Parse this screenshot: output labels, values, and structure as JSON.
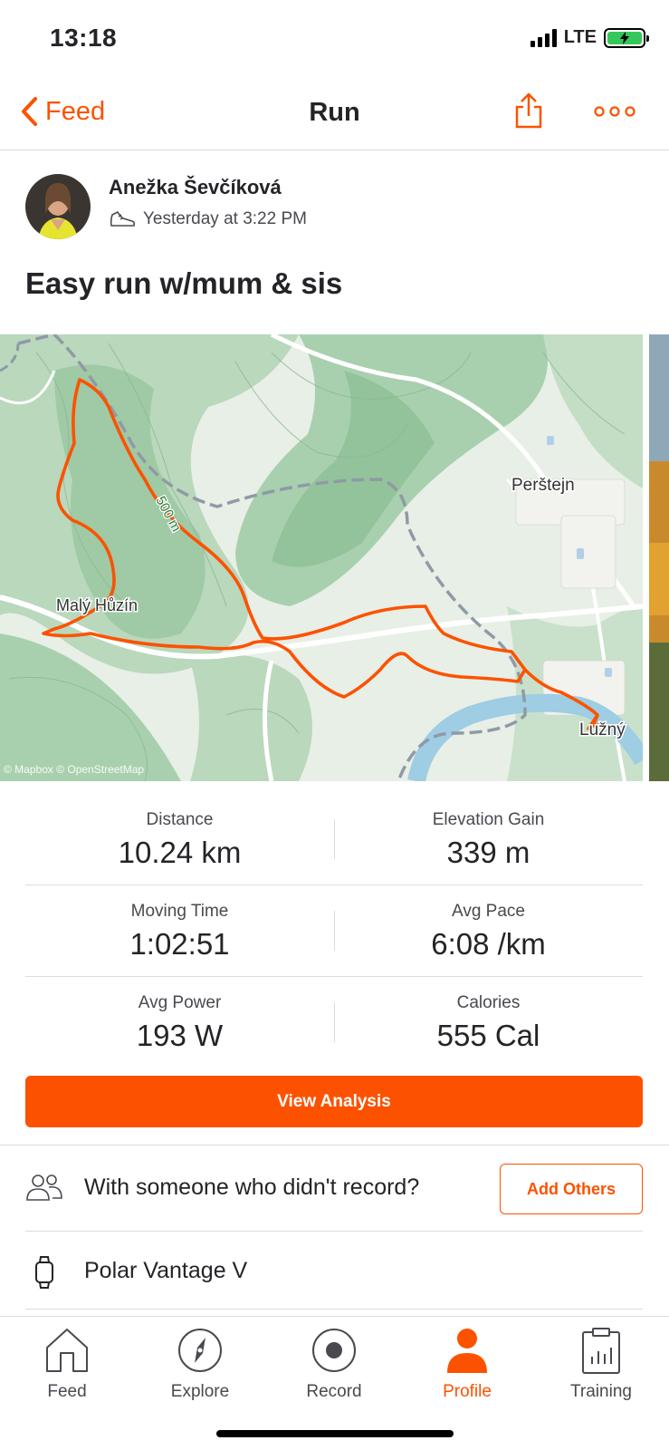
{
  "status": {
    "time": "13:18",
    "network": "LTE"
  },
  "nav": {
    "back_label": "Feed",
    "title": "Run"
  },
  "athlete": {
    "name": "Anežka Ševčíková",
    "timestamp": "Yesterday at 3:22 PM"
  },
  "activity": {
    "title": "Easy run w/mum & sis"
  },
  "map": {
    "labels": {
      "town_1": "Perštejn",
      "town_2": "Malý Hůzín",
      "town_3": "Lužný",
      "contour": "500 m",
      "attribution": "© Mapbox © OpenStreetMap"
    },
    "route_color": "#fc5200"
  },
  "stats": [
    {
      "label": "Distance",
      "value": "10.24 km"
    },
    {
      "label": "Elevation Gain",
      "value": "339 m"
    },
    {
      "label": "Moving Time",
      "value": "1:02:51"
    },
    {
      "label": "Avg Pace",
      "value": "6:08 /km"
    },
    {
      "label": "Avg Power",
      "value": "193 W"
    },
    {
      "label": "Calories",
      "value": "555 Cal"
    }
  ],
  "actions": {
    "view_analysis": "View Analysis",
    "others_prompt": "With someone who didn't record?",
    "add_others": "Add Others",
    "device": "Polar Vantage V"
  },
  "tabs": [
    {
      "label": "Feed",
      "icon": "home-icon",
      "active": false
    },
    {
      "label": "Explore",
      "icon": "compass-icon",
      "active": false
    },
    {
      "label": "Record",
      "icon": "record-icon",
      "active": false
    },
    {
      "label": "Profile",
      "icon": "profile-icon",
      "active": true
    },
    {
      "label": "Training",
      "icon": "training-icon",
      "active": false
    }
  ],
  "colors": {
    "accent": "#fc5200",
    "text": "#242428",
    "muted": "#494950"
  }
}
